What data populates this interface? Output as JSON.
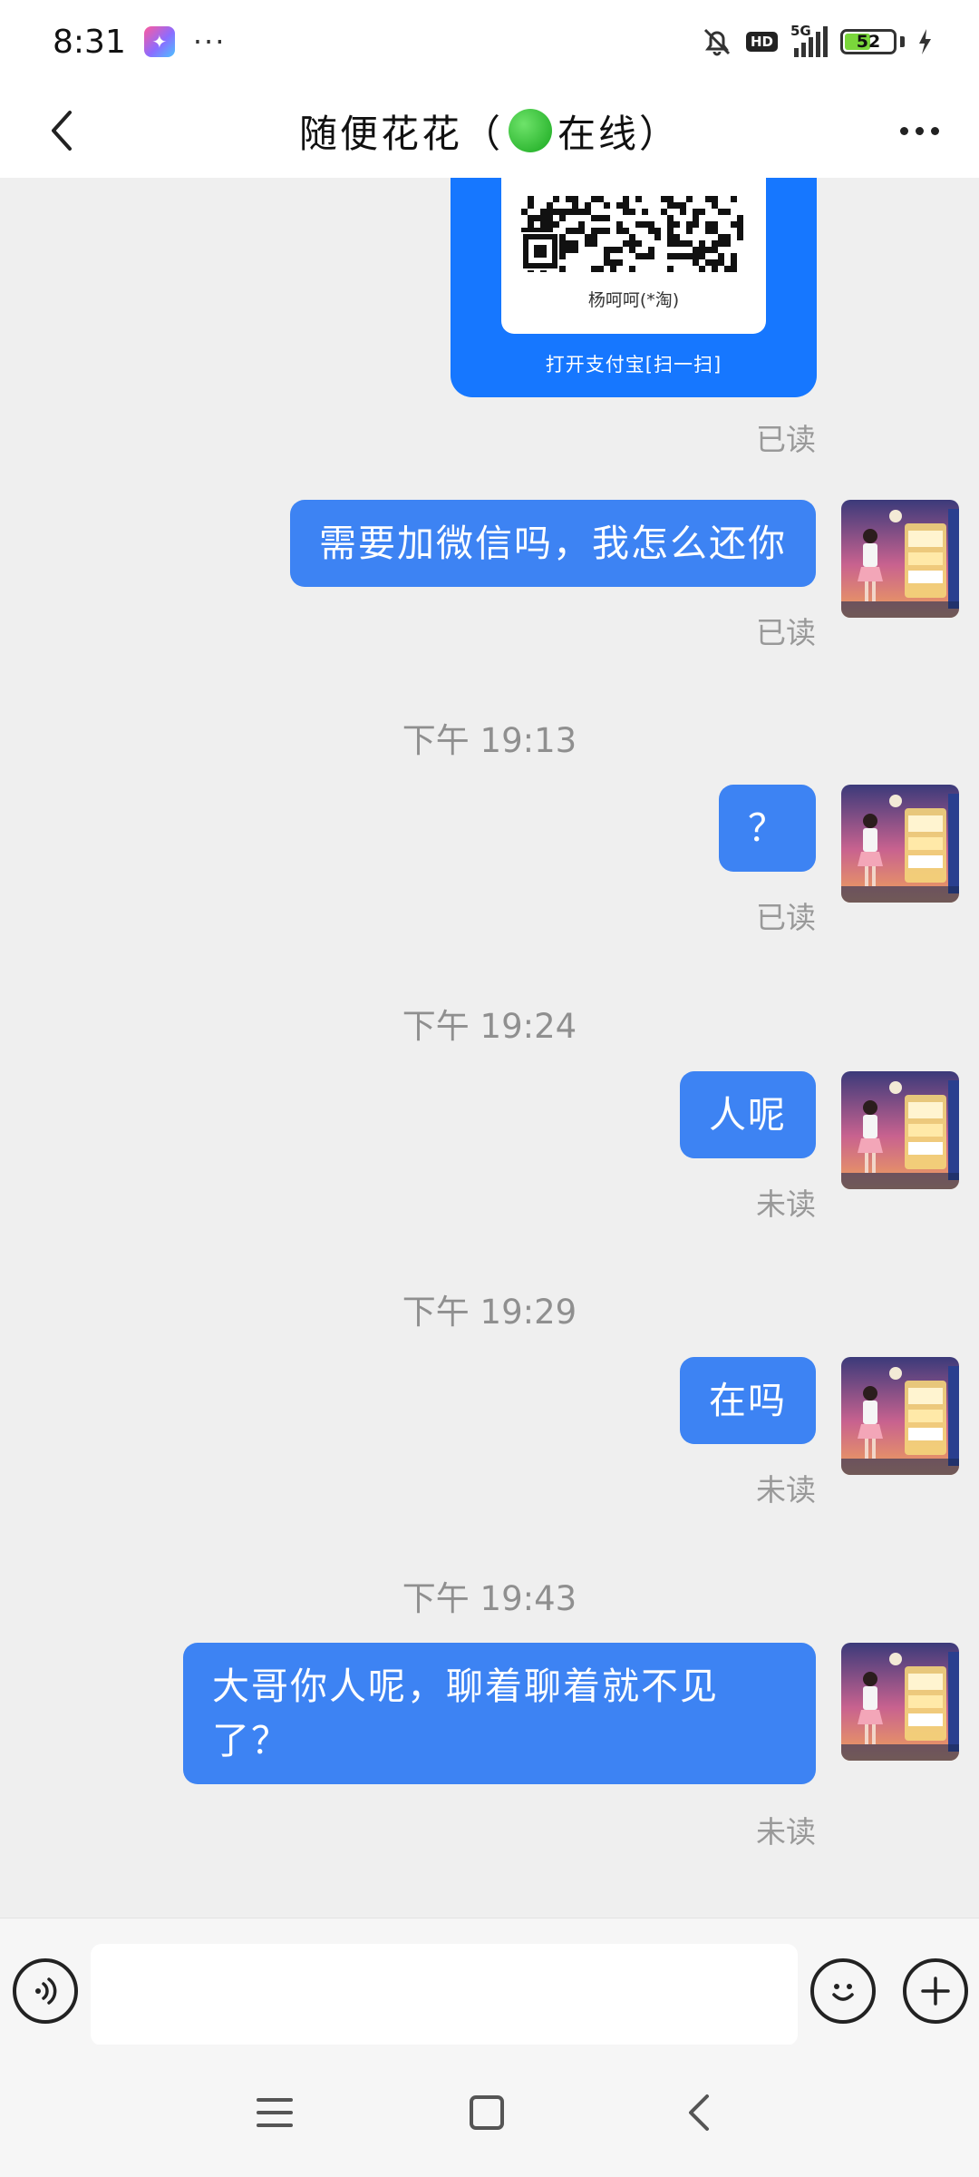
{
  "status_bar": {
    "time": "8:31",
    "more": "···",
    "network": "5G",
    "hd": "HD",
    "battery_level": "52",
    "battery_fraction": 0.52
  },
  "header": {
    "title_name": "随便花花",
    "title_open": "（",
    "title_status": "在线",
    "title_close": "）"
  },
  "qr_card": {
    "name": "杨呵呵(*淘)",
    "caption": "打开支付宝[扫一扫]"
  },
  "messages": [
    {
      "text": "需要加微信吗，我怎么还你",
      "receipt": "已读"
    },
    {
      "timestamp": "下午 19:13",
      "text": "？",
      "receipt": "已读"
    },
    {
      "timestamp": "下午 19:24",
      "text": "人呢",
      "receipt": "未读"
    },
    {
      "timestamp": "下午 19:29",
      "text": "在吗",
      "receipt": "未读"
    },
    {
      "timestamp": "下午 19:43",
      "text_line1": "大哥你人呢，聊着聊着就不见",
      "text_line2": "了？",
      "receipt": "未读"
    }
  ],
  "qr_receipt": "已读",
  "input": {
    "placeholder": ""
  },
  "colors": {
    "bubble": "#3d83f3",
    "qr_card": "#1677ff",
    "background": "#efefef",
    "online": "#22b12a"
  },
  "icons": {
    "back": "chevron-left-icon",
    "more": "more-horizontal-icon",
    "voice": "voice-icon",
    "emoji": "smile-icon",
    "plus": "plus-icon",
    "nav_menu": "menu-icon",
    "nav_home": "square-icon",
    "nav_back": "chevron-left-icon"
  }
}
